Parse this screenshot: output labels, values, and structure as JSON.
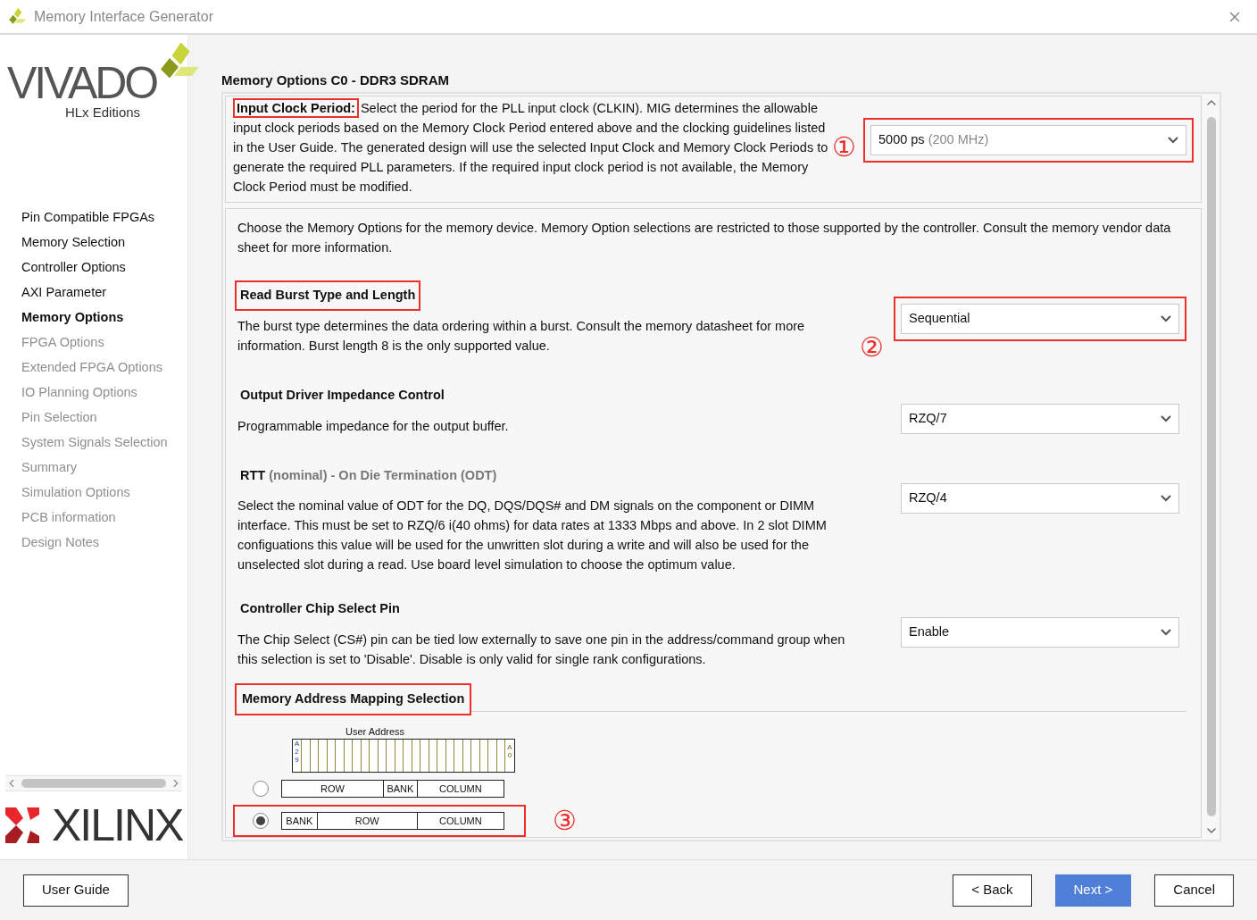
{
  "window": {
    "title": "Memory Interface Generator"
  },
  "branding": {
    "product": "VIVADO",
    "edition": "HLx Editions",
    "company": "XILINX"
  },
  "sidebar": {
    "items": [
      {
        "label": "Pin Compatible FPGAs",
        "selected": false,
        "disabled": false
      },
      {
        "label": "Memory Selection",
        "selected": false,
        "disabled": false
      },
      {
        "label": "Controller Options",
        "selected": false,
        "disabled": false
      },
      {
        "label": "AXI Parameter",
        "selected": false,
        "disabled": false
      },
      {
        "label": "Memory Options",
        "selected": true,
        "disabled": false
      },
      {
        "label": "FPGA Options",
        "selected": false,
        "disabled": true
      },
      {
        "label": "Extended FPGA Options",
        "selected": false,
        "disabled": true
      },
      {
        "label": "IO Planning Options",
        "selected": false,
        "disabled": true
      },
      {
        "label": "Pin Selection",
        "selected": false,
        "disabled": true
      },
      {
        "label": "System Signals Selection",
        "selected": false,
        "disabled": true
      },
      {
        "label": "Summary",
        "selected": false,
        "disabled": true
      },
      {
        "label": "Simulation Options",
        "selected": false,
        "disabled": true
      },
      {
        "label": "PCB information",
        "selected": false,
        "disabled": true
      },
      {
        "label": "Design Notes",
        "selected": false,
        "disabled": true
      }
    ]
  },
  "page_title": "Memory Options C0 - DDR3 SDRAM",
  "clock_panel": {
    "label": "Input Clock Period:",
    "label_highlighted": true,
    "description": "Select the period for the PLL input clock (CLKIN). MIG determines the allowable input clock periods based on the Memory Clock Period entered above and the clocking guidelines listed in the User Guide. The generated design will use the selected Input Clock and Memory Clock Periods to generate the required PLL parameters. If the required input clock period is not available, the Memory Clock Period must be modified.",
    "marker": "①",
    "dropdown": {
      "value": "5000 ps",
      "hint": "(200 MHz)",
      "highlighted": true
    }
  },
  "memory_panel": {
    "intro": "Choose the Memory Options for the memory device. Memory Option selections are restricted to those supported by the controller. Consult the memory vendor data sheet for more information.",
    "options": [
      {
        "title": "Read Burst Type and Length",
        "title_highlighted": true,
        "description": "The burst type determines the data ordering within a burst. Consult the memory datasheet for more information. Burst length 8 is the only supported value.",
        "marker": "②",
        "dropdown": {
          "value": "Sequential",
          "highlighted": true
        }
      },
      {
        "title": "Output Driver Impedance Control",
        "title_highlighted": false,
        "description": "Programmable impedance for the output buffer.",
        "dropdown": {
          "value": "RZQ/7",
          "highlighted": false
        }
      },
      {
        "title": "RTT",
        "title_note": "(nominal) - On Die Termination (ODT)",
        "title_highlighted": false,
        "description": "Select the nominal value of ODT for the DQ, DQS/DQS# and DM signals on the component or DIMM interface. This must be set to RZQ/6 i(40 ohms) for data rates at 1333 Mbps and above. In 2 slot DIMM configuations this value will be used for the unwritten slot during a write and will also be used for the unselected slot during a read. Use board level simulation to choose the optimum value.",
        "dropdown": {
          "value": "RZQ/4",
          "highlighted": false
        }
      },
      {
        "title": "Controller Chip Select Pin",
        "title_highlighted": false,
        "description": "The Chip Select (CS#) pin can be tied low externally to save one pin in the address/command group when this selection is set to 'Disable'. Disable is only valid for single rank configurations.",
        "dropdown": {
          "value": "Enable",
          "highlighted": false
        }
      }
    ]
  },
  "address_mapping": {
    "title": "Memory Address Mapping Selection",
    "title_highlighted": true,
    "diagram_label": "User Address",
    "msb": "A29",
    "lsb": "A0",
    "options": [
      {
        "selected": false,
        "highlighted": false,
        "fields": [
          "ROW",
          "BANK",
          "COLUMN"
        ]
      },
      {
        "selected": true,
        "highlighted": true,
        "marker": "③",
        "fields": [
          "BANK",
          "ROW",
          "COLUMN"
        ]
      }
    ]
  },
  "footer": {
    "buttons": [
      {
        "label": "User Guide",
        "kind": "default"
      },
      {
        "label": "< Back",
        "kind": "default"
      },
      {
        "label": "Next >",
        "kind": "primary"
      },
      {
        "label": "Cancel",
        "kind": "default"
      }
    ]
  }
}
